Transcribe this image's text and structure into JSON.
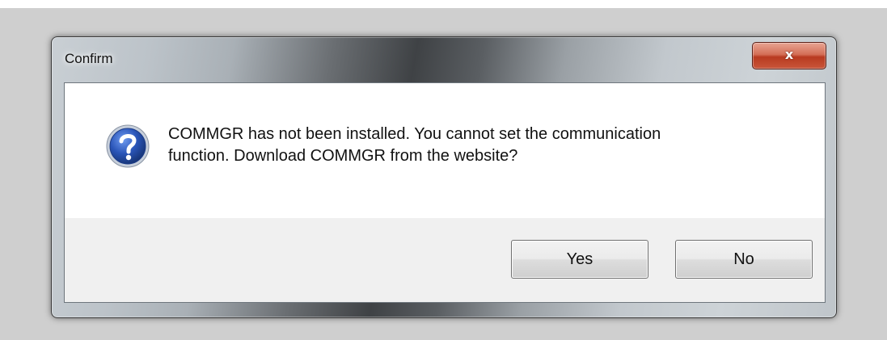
{
  "dialog": {
    "title": "Confirm",
    "close_symbol": "x",
    "message_line1": "COMMGR has not been installed. You cannot set the communication",
    "message_line2": "function. Download COMMGR from the website?",
    "icon": "question-icon",
    "buttons": {
      "yes_label": "Yes",
      "no_label": "No"
    }
  },
  "colors": {
    "close_button": "#c9563a",
    "icon_blue": "#2a55b8",
    "client_background": "#ffffff",
    "button_panel": "#f0f0f0"
  }
}
